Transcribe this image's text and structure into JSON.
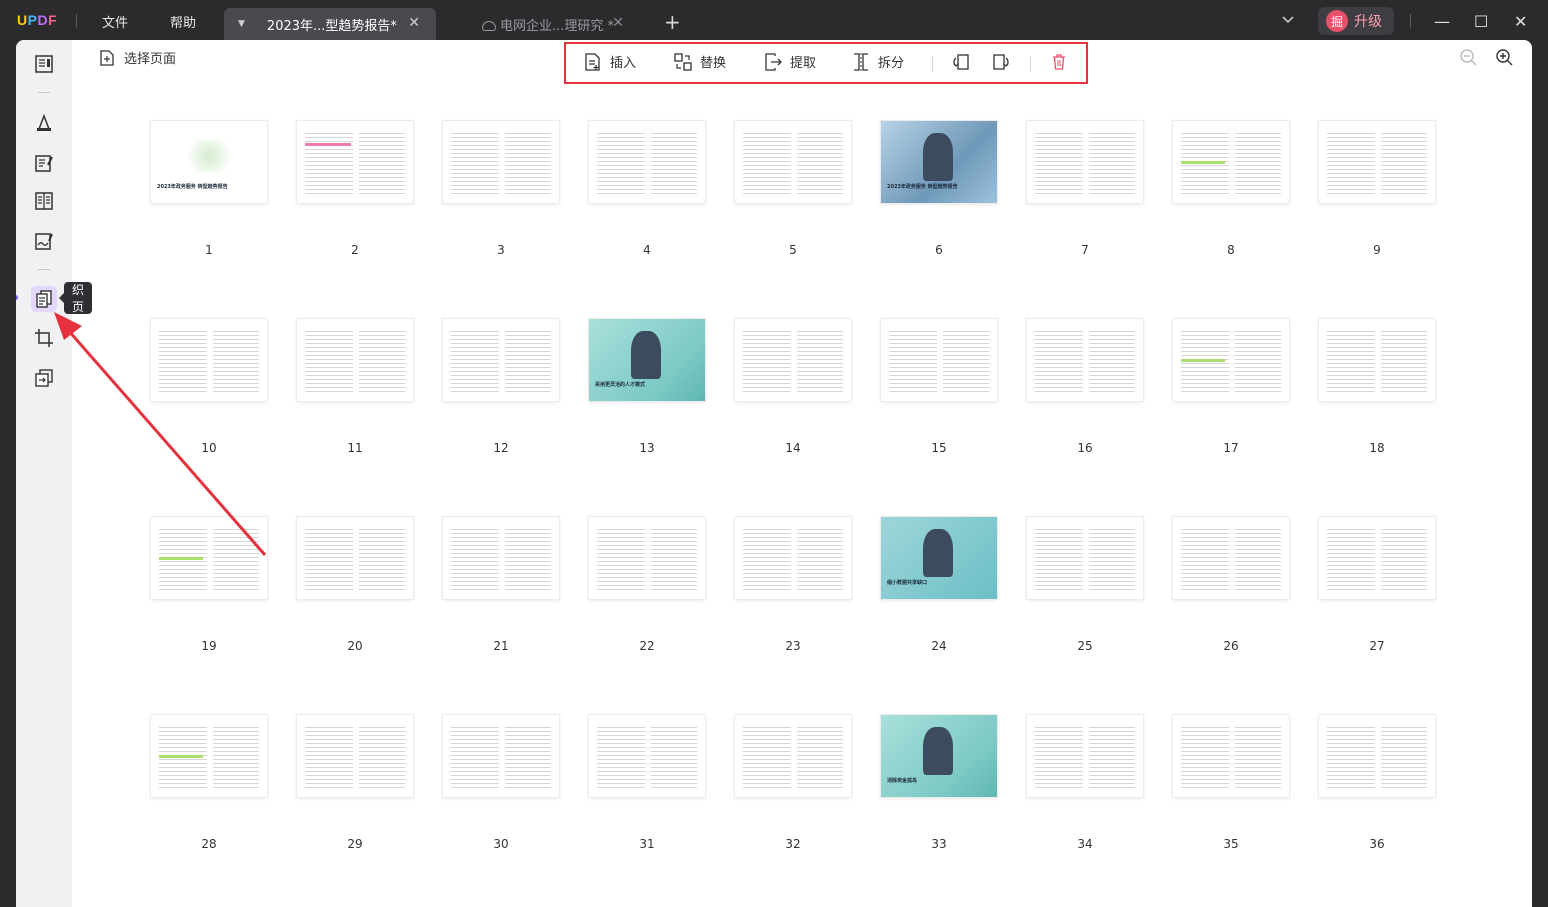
{
  "app": {
    "logo": "UPDF",
    "menus": [
      "文件",
      "帮助"
    ],
    "tabs": [
      {
        "label": "2023年...型趋势报告*",
        "active": true
      },
      {
        "label": "电网企业...理研究 *",
        "active": false
      }
    ],
    "upgrade": {
      "avatar": "掘",
      "label": "升级"
    }
  },
  "sidebar": {
    "tooltip": "组织页面",
    "items": [
      "reader-icon",
      "comment-icon",
      "edit-icon",
      "form-icon",
      "sign-icon",
      "organize-pages-icon",
      "crop-icon",
      "convert-icon"
    ]
  },
  "toolbar": {
    "select_pages": "选择页面",
    "insert": "插入",
    "replace": "替换",
    "extract": "提取",
    "split": "拆分"
  },
  "pages": [
    "1",
    "2",
    "3",
    "4",
    "5",
    "6",
    "7",
    "8",
    "9",
    "10",
    "11",
    "12",
    "13",
    "14",
    "15",
    "16",
    "17",
    "18",
    "19",
    "20",
    "21",
    "22",
    "23",
    "24",
    "25",
    "26",
    "27",
    "28",
    "29",
    "30",
    "31",
    "32",
    "33",
    "34",
    "35",
    "36"
  ],
  "thumb_captions": {
    "p1": "2023年政务服务 转型趋势报告",
    "p6": "2023年政务服务 转型趋势报告",
    "p13": "采用更灵活的人才模式",
    "p24": "缩小数据共享缺口",
    "p33": "消除资金孤岛"
  },
  "colors": {
    "accent": "#7b5cff",
    "highlight_box": "#e5323e",
    "arrow": "#e5323e"
  }
}
